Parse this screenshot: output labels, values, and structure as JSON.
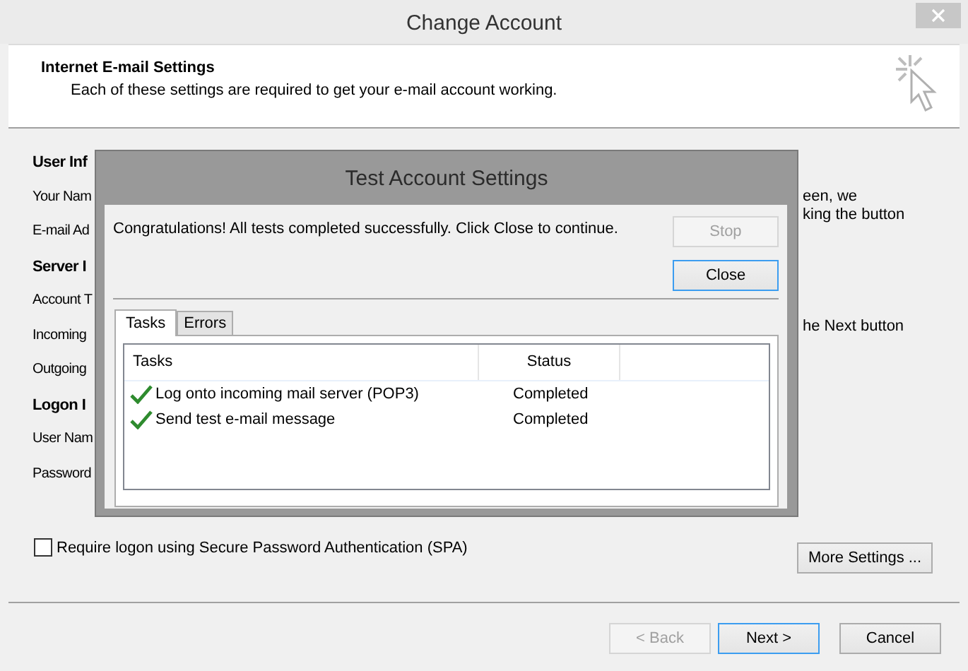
{
  "window": {
    "title": "Change Account"
  },
  "header": {
    "title": "Internet E-mail Settings",
    "subtitle": "Each of these settings are required to get your e-mail account working."
  },
  "form": {
    "left": [
      {
        "kind": "heading",
        "text": "User Inf"
      },
      {
        "kind": "label",
        "text": "Your Nam"
      },
      {
        "kind": "label",
        "text": "E-mail Ad"
      },
      {
        "kind": "heading",
        "text": "Server I"
      },
      {
        "kind": "label",
        "text": "Account T"
      },
      {
        "kind": "label",
        "text": "Incoming"
      },
      {
        "kind": "label",
        "text": "Outgoing"
      },
      {
        "kind": "heading",
        "text": "Logon I"
      },
      {
        "kind": "label",
        "text": "User Nam"
      },
      {
        "kind": "label",
        "text": "Password"
      }
    ],
    "right_paragraphs": [
      [
        "een, we",
        "king the button"
      ],
      [
        "he Next button"
      ]
    ]
  },
  "spa": {
    "label": "Require logon using Secure Password Authentication (SPA)",
    "checked": false
  },
  "more_settings": "More Settings ...",
  "footer_buttons": [
    {
      "label": "< Back",
      "disabled": true,
      "default": false
    },
    {
      "label": "Next >",
      "disabled": false,
      "default": true
    },
    {
      "label": "Cancel",
      "disabled": false,
      "default": false
    }
  ],
  "dialog": {
    "title": "Test Account Settings",
    "message": "Congratulations! All tests completed successfully. Click Close to continue.",
    "buttons": [
      {
        "label": "Stop",
        "disabled": true,
        "default": false
      },
      {
        "label": "Close",
        "disabled": false,
        "default": true
      }
    ],
    "tabs": [
      {
        "label": "Tasks",
        "selected": true
      },
      {
        "label": "Errors",
        "selected": false
      }
    ],
    "columns": [
      "Tasks",
      "Status"
    ],
    "rows": [
      {
        "task": "Log onto incoming mail server (POP3)",
        "status": "Completed",
        "done": true
      },
      {
        "task": "Send test e-mail message",
        "status": "Completed",
        "done": true
      }
    ]
  }
}
